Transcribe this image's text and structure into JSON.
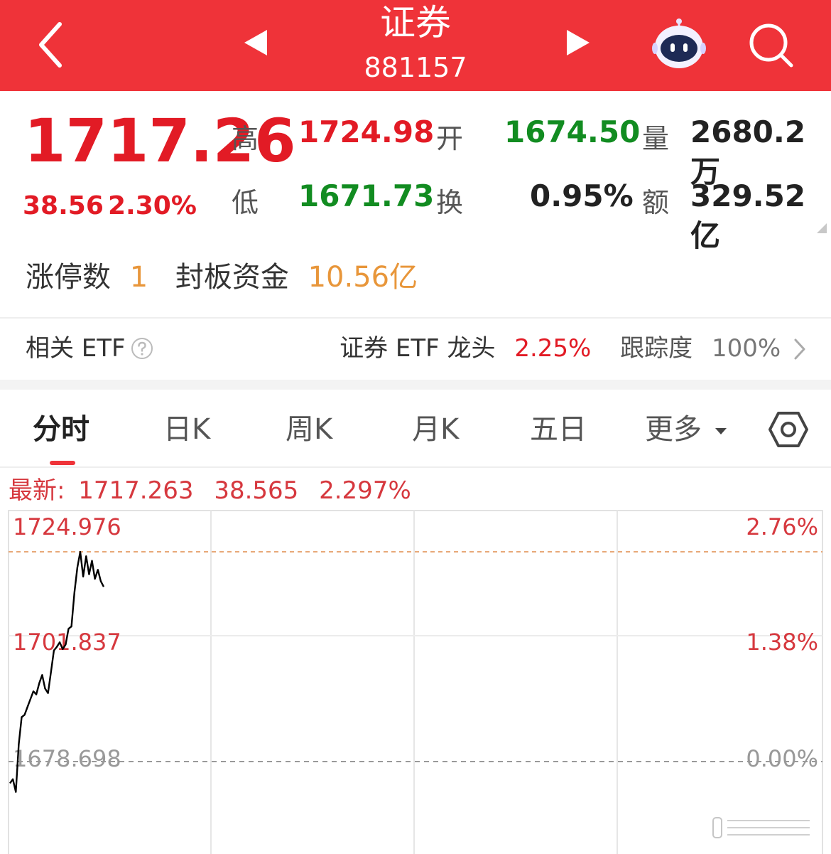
{
  "header": {
    "title": "证券",
    "code": "881157",
    "colors": {
      "bar": "#ef3339"
    }
  },
  "quote": {
    "price": "1717.26",
    "change": "38.56",
    "change_pct": "2.30%",
    "high_label": "高",
    "high": "1724.98",
    "low_label": "低",
    "low": "1671.73",
    "open_label": "开",
    "open": "1674.50",
    "turnover_label": "换",
    "turnover": "0.95%",
    "volume_label": "量",
    "volume": "2680.2万",
    "amount_label": "额",
    "amount": "329.52亿"
  },
  "limit": {
    "count_label": "涨停数",
    "count": "1",
    "fund_label": "封板资金",
    "fund": "10.56亿"
  },
  "etf": {
    "label": "相关 ETF",
    "name": "证券 ETF 龙头",
    "pct": "2.25%",
    "tracking_label": "跟踪度",
    "tracking": "100%"
  },
  "tabs": [
    "分时",
    "日K",
    "周K",
    "月K",
    "五日",
    "更多"
  ],
  "latest": {
    "label": "最新:",
    "price": "1717.263",
    "change": "38.565",
    "pct": "2.297%"
  },
  "chart_data": {
    "type": "line",
    "y_ticks_left": [
      "1724.976",
      "1701.837",
      "1678.698"
    ],
    "y_ticks_right": [
      "2.76%",
      "1.38%",
      "0.00%"
    ],
    "ylim": [
      1655.56,
      1724.976
    ],
    "reference_line": 1678.698,
    "grid": true,
    "series": [
      {
        "values": [
          1673.9,
          1674.8,
          1672.0,
          1682.5,
          1688.5,
          1689.0,
          1690.8,
          1692.5,
          1694.2,
          1693.5,
          1696.0,
          1697.8,
          1694.8,
          1693.8,
          1698.5,
          1703.2,
          1704.0,
          1705.0,
          1703.5,
          1704.5,
          1708.0,
          1708.5,
          1716.0,
          1721.5,
          1724.976,
          1719.5,
          1724.0,
          1720.0,
          1723.0,
          1719.0,
          1721.0,
          1718.5,
          1717.263
        ]
      }
    ],
    "colors": {
      "line": "#000000",
      "tick_red": "#d6383e",
      "tick_gray": "#999999"
    }
  }
}
